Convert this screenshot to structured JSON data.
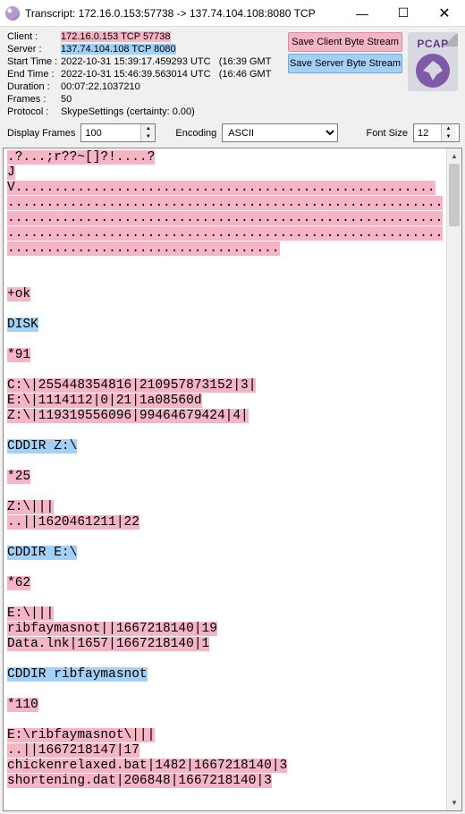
{
  "window": {
    "title": "Transcript: 172.16.0.153:57738 -> 137.74.104.108:8080 TCP"
  },
  "meta": {
    "client_label": "Client :",
    "server_label": "Server :",
    "start_label": "Start Time :",
    "end_label": "End Time :",
    "duration_label": "Duration :",
    "frames_label": "Frames :",
    "protocol_label": "Protocol :",
    "client_val": "172.16.0.153 TCP 57738",
    "server_val": "137.74.104.108 TCP 8080",
    "start_val": "2022-10-31 15:39:17.459293 UTC",
    "start_local": "(16:39 GMT",
    "end_val": "2022-10-31 15:46:39.563014 UTC",
    "end_local": "(16:46 GMT",
    "duration_val": "00:07:22.1037210",
    "frames_val": "50",
    "protocol_val": "SkypeSettings (certainty: 0.00)"
  },
  "buttons": {
    "save_client": "Save Client Byte Stream",
    "save_server": "Save Server Byte Stream"
  },
  "pcap_label": "PCAP",
  "toolbar": {
    "display_frames_label": "Display Frames",
    "display_frames_val": "100",
    "encoding_label": "Encoding",
    "encoding_val": "ASCII",
    "fontsize_label": "Font Size",
    "fontsize_val": "12"
  },
  "transcript": [
    {
      "who": "c",
      "text": ".?...;r??~[]?!....?"
    },
    {
      "who": "c",
      "text": "JV......................................................"
    },
    {
      "who": "c",
      "text": "........................................................"
    },
    {
      "who": "c",
      "text": "........................................................"
    },
    {
      "who": "c",
      "text": "........................................................"
    },
    {
      "who": "c",
      "text": "..................................."
    },
    {
      "who": "",
      "text": ""
    },
    {
      "who": "",
      "text": ""
    },
    {
      "who": "c",
      "text": "+ok"
    },
    {
      "who": "",
      "text": ""
    },
    {
      "who": "s",
      "text": "DISK"
    },
    {
      "who": "",
      "text": ""
    },
    {
      "who": "c",
      "text": "*91"
    },
    {
      "who": "",
      "text": ""
    },
    {
      "who": "c",
      "text": "C:\\|255448354816|210957873152|3|"
    },
    {
      "who": "c",
      "text": "E:\\|1114112|0|21|1a08560d"
    },
    {
      "who": "c",
      "text": "Z:\\|119319556096|99464679424|4|"
    },
    {
      "who": "",
      "text": ""
    },
    {
      "who": "s",
      "text": "CDDIR Z:\\"
    },
    {
      "who": "",
      "text": ""
    },
    {
      "who": "c",
      "text": "*25"
    },
    {
      "who": "",
      "text": ""
    },
    {
      "who": "c",
      "text": "Z:\\|||"
    },
    {
      "who": "c",
      "text": "..||1620461211|22"
    },
    {
      "who": "",
      "text": ""
    },
    {
      "who": "s",
      "text": "CDDIR E:\\"
    },
    {
      "who": "",
      "text": ""
    },
    {
      "who": "c",
      "text": "*62"
    },
    {
      "who": "",
      "text": ""
    },
    {
      "who": "c",
      "text": "E:\\|||"
    },
    {
      "who": "c",
      "text": "ribfaymasnot||1667218140|19"
    },
    {
      "who": "c",
      "text": "Data.lnk|1657|1667218140|1"
    },
    {
      "who": "",
      "text": ""
    },
    {
      "who": "s",
      "text": "CDDIR ribfaymasnot"
    },
    {
      "who": "",
      "text": ""
    },
    {
      "who": "c",
      "text": "*110"
    },
    {
      "who": "",
      "text": ""
    },
    {
      "who": "c",
      "text": "E:\\ribfaymasnot\\|||"
    },
    {
      "who": "c",
      "text": "..||1667218147|17"
    },
    {
      "who": "c",
      "text": "chickenrelaxed.bat|1482|1667218140|3"
    },
    {
      "who": "c",
      "text": "shortening.dat|206848|1667218140|3"
    }
  ]
}
